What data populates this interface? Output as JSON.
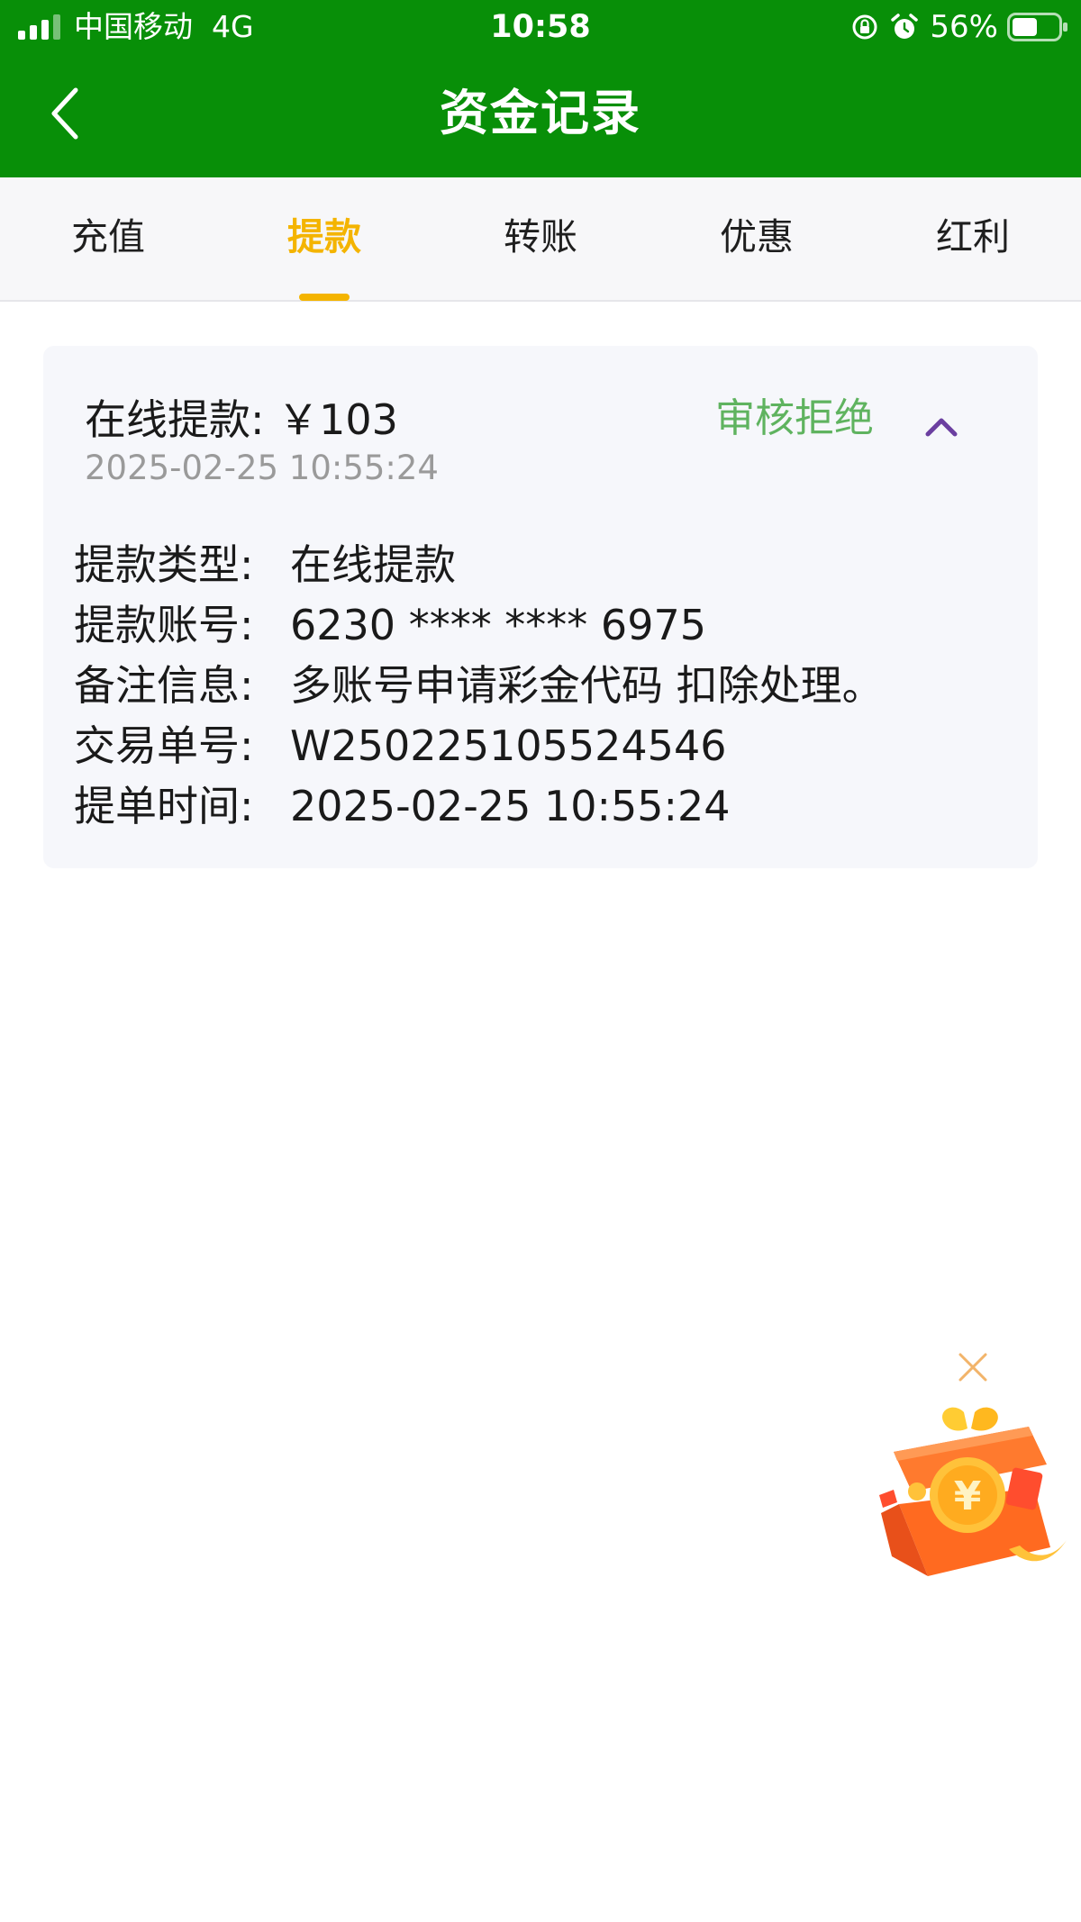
{
  "status_bar": {
    "carrier": "中国移动",
    "network": "4G",
    "time": "10:58",
    "battery": "56%",
    "battery_level": 0.56,
    "icons": [
      "signal-icon",
      "orientation-lock-icon",
      "alarm-icon",
      "battery-icon"
    ]
  },
  "nav": {
    "title": "资金记录",
    "back_icon": "chevron-left-icon"
  },
  "tabs": {
    "items": [
      {
        "label": "充值"
      },
      {
        "label": "提款"
      },
      {
        "label": "转账"
      },
      {
        "label": "优惠"
      },
      {
        "label": "红利"
      }
    ],
    "active_index": 1
  },
  "record": {
    "title": "在线提款: ￥103",
    "time": "2025-02-25 10:55:24",
    "status": "审核拒绝",
    "toggle_icon": "chevron-up-icon",
    "details": [
      {
        "label": "提款类型:",
        "value": "在线提款"
      },
      {
        "label": "提款账号:",
        "value": "6230 **** **** 6975"
      },
      {
        "label": "备注信息:",
        "value": "多账号申请彩金代码 扣除处理。"
      },
      {
        "label": "交易单号:",
        "value": "W250225105524546"
      },
      {
        "label": "提单时间:",
        "value": "2025-02-25 10:55:24"
      }
    ]
  },
  "promo": {
    "close_icon": "close-icon",
    "gift_icon": "gift-box-icon"
  },
  "colors": {
    "header_bg": "#088f08",
    "tab_active": "#f4b400",
    "status_rejected": "#5fb35f",
    "chevron": "#6b3fa0",
    "card_bg": "#f6f7fb"
  }
}
